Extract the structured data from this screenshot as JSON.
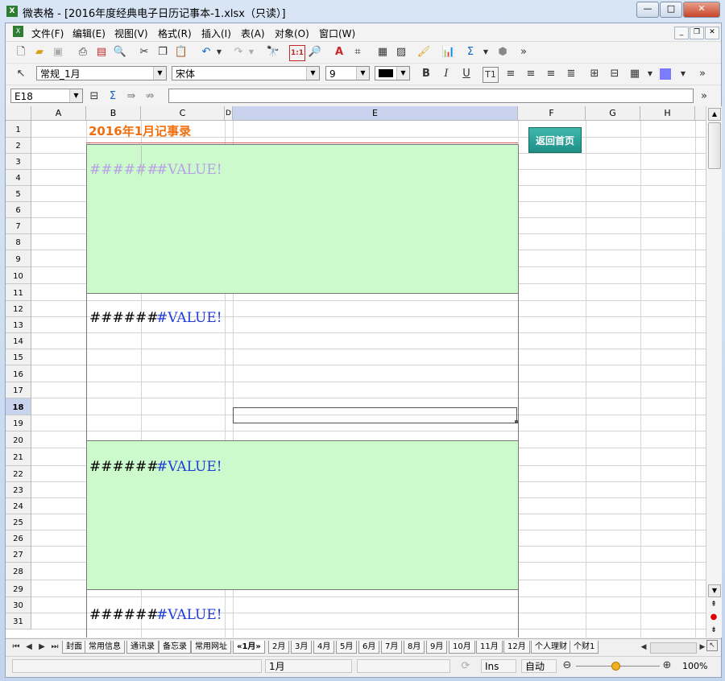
{
  "window": {
    "title": "微表格 - [2016年度经典电子日历记事本-1.xlsx（只读）]",
    "app_icon": "X"
  },
  "menu": [
    "文件(F)",
    "编辑(E)",
    "视图(V)",
    "格式(R)",
    "插入(I)",
    "表(A)",
    "对象(O)",
    "窗口(W)"
  ],
  "format_bar": {
    "style": "常规_1月",
    "font": "宋体",
    "size": "9"
  },
  "formula_bar": {
    "cell_ref": "E18",
    "content": ""
  },
  "columns": [
    "A",
    "B",
    "C",
    "D",
    "E",
    "F",
    "G",
    "H"
  ],
  "rows": [
    "1",
    "2",
    "3",
    "4",
    "5",
    "6",
    "7",
    "8",
    "9",
    "10",
    "11",
    "12",
    "13",
    "14",
    "15",
    "16",
    "17",
    "18",
    "19",
    "20",
    "21",
    "22",
    "23",
    "24",
    "25",
    "26",
    "27",
    "28",
    "29",
    "30",
    "31"
  ],
  "sheet": {
    "heading": "2016年1月记事录",
    "back_button": "返回首页",
    "blocks": [
      {
        "date": "######",
        "weekday": "#VALUE!",
        "faded": true
      },
      {
        "date": "######",
        "weekday": "#VALUE!",
        "faded": false
      },
      {
        "date": "######",
        "weekday": "#VALUE!",
        "faded": false
      },
      {
        "date": "######",
        "weekday": "#VALUE!",
        "faded": false
      }
    ]
  },
  "tabs": [
    "封面",
    "常用信息",
    "通讯录",
    "备忘录",
    "常用网址",
    "«1月»",
    "2月",
    "3月",
    "4月",
    "5月",
    "6月",
    "7月",
    "8月",
    "9月",
    "10月",
    "11月",
    "12月",
    "个人理财",
    "个财1"
  ],
  "active_tab_index": 5,
  "status": {
    "sheet": "1月",
    "mode": "Ins",
    "calc": "自动",
    "zoom": "100%"
  },
  "colors": {
    "green_fill": "#ccfacc",
    "heading": "#f07010",
    "button": "#2aa39a",
    "faded_text": "#b8a0e6",
    "text_blue": "#1f3cd6"
  }
}
